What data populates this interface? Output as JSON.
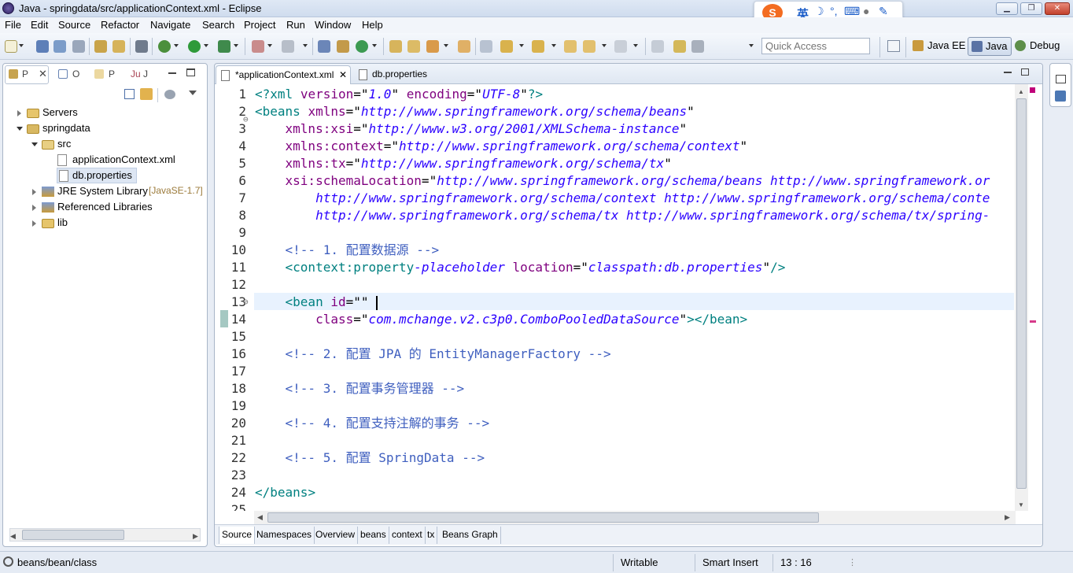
{
  "window": {
    "title": "Java - springdata/src/applicationContext.xml - Eclipse"
  },
  "ime": {
    "label": "英"
  },
  "menu": [
    "File",
    "Edit",
    "Source",
    "Refactor",
    "Navigate",
    "Search",
    "Project",
    "Run",
    "Window",
    "Help"
  ],
  "quick_access": {
    "placeholder": "Quick Access"
  },
  "perspectives": {
    "java_ee": "Java EE",
    "java": "Java",
    "debug": "Debug"
  },
  "left_panel": {
    "tabs": [
      "P",
      "O",
      "P",
      "J"
    ],
    "tree": [
      {
        "label": "Servers",
        "depth": 0,
        "state": "collapsed",
        "icon": "folder-icon"
      },
      {
        "label": "springdata",
        "depth": 0,
        "state": "expanded",
        "icon": "project-icon"
      },
      {
        "label": "src",
        "depth": 1,
        "state": "expanded",
        "icon": "package-folder-icon"
      },
      {
        "label": "applicationContext.xml",
        "depth": 2,
        "state": "leaf",
        "icon": "xml-file-icon"
      },
      {
        "label": "db.properties",
        "depth": 2,
        "state": "leaf",
        "icon": "properties-file-icon",
        "selected": true
      },
      {
        "label": "JRE System Library",
        "suffix": "[JavaSE-1.7]",
        "depth": 1,
        "state": "collapsed",
        "icon": "library-icon"
      },
      {
        "label": "Referenced Libraries",
        "depth": 1,
        "state": "collapsed",
        "icon": "library-icon"
      },
      {
        "label": "lib",
        "depth": 1,
        "state": "collapsed",
        "icon": "folder-icon"
      }
    ]
  },
  "editor": {
    "tabs": [
      {
        "label": "*applicationContext.xml",
        "active": true
      },
      {
        "label": "db.properties",
        "active": false
      }
    ],
    "line_numbers": [
      "1",
      "2",
      "3",
      "4",
      "5",
      "6",
      "7",
      "8",
      "9",
      "10",
      "11",
      "12",
      "13",
      "14",
      "15",
      "16",
      "17",
      "18",
      "19",
      "20",
      "21",
      "22",
      "23",
      "24",
      "25"
    ],
    "lines": [
      "<?xml version=\"1.0\" encoding=\"UTF-8\"?>",
      "<beans xmlns=\"http://www.springframework.org/schema/beans\"",
      "    xmlns:xsi=\"http://www.w3.org/2001/XMLSchema-instance\"",
      "    xmlns:context=\"http://www.springframework.org/schema/context\"",
      "    xmlns:tx=\"http://www.springframework.org/schema/tx\"",
      "    xsi:schemaLocation=\"http://www.springframework.org/schema/beans http://www.springframework.or",
      "        http://www.springframework.org/schema/context http://www.springframework.org/schema/conte",
      "        http://www.springframework.org/schema/tx http://www.springframework.org/schema/tx/spring-",
      "",
      "    <!-- 1. 配置数据源 -->",
      "    <context:property-placeholder location=\"classpath:db.properties\"/>",
      "",
      "    <bean id=\"\"",
      "        class=\"com.mchange.v2.c3p0.ComboPooledDataSource\"></bean>",
      "",
      "    <!-- 2. 配置 JPA 的 EntityManagerFactory -->",
      "",
      "    <!-- 3. 配置事务管理器 -->",
      "",
      "    <!-- 4. 配置支持注解的事务 -->",
      "",
      "    <!-- 5. 配置 SpringData -->",
      "",
      "</beans>",
      ""
    ],
    "bottom_tabs": [
      "Source",
      "Namespaces",
      "Overview",
      "beans",
      "context",
      "tx",
      "Beans Graph"
    ]
  },
  "status": {
    "path": "beans/bean/class",
    "mode": "Writable",
    "insert": "Smart Insert",
    "position": "13 : 16"
  },
  "colors": {
    "tag": "#008080",
    "attr": "#7f007f",
    "value": "#2a00ff",
    "comment": "#3f5fbf",
    "current_line": "#e8f2fe"
  }
}
